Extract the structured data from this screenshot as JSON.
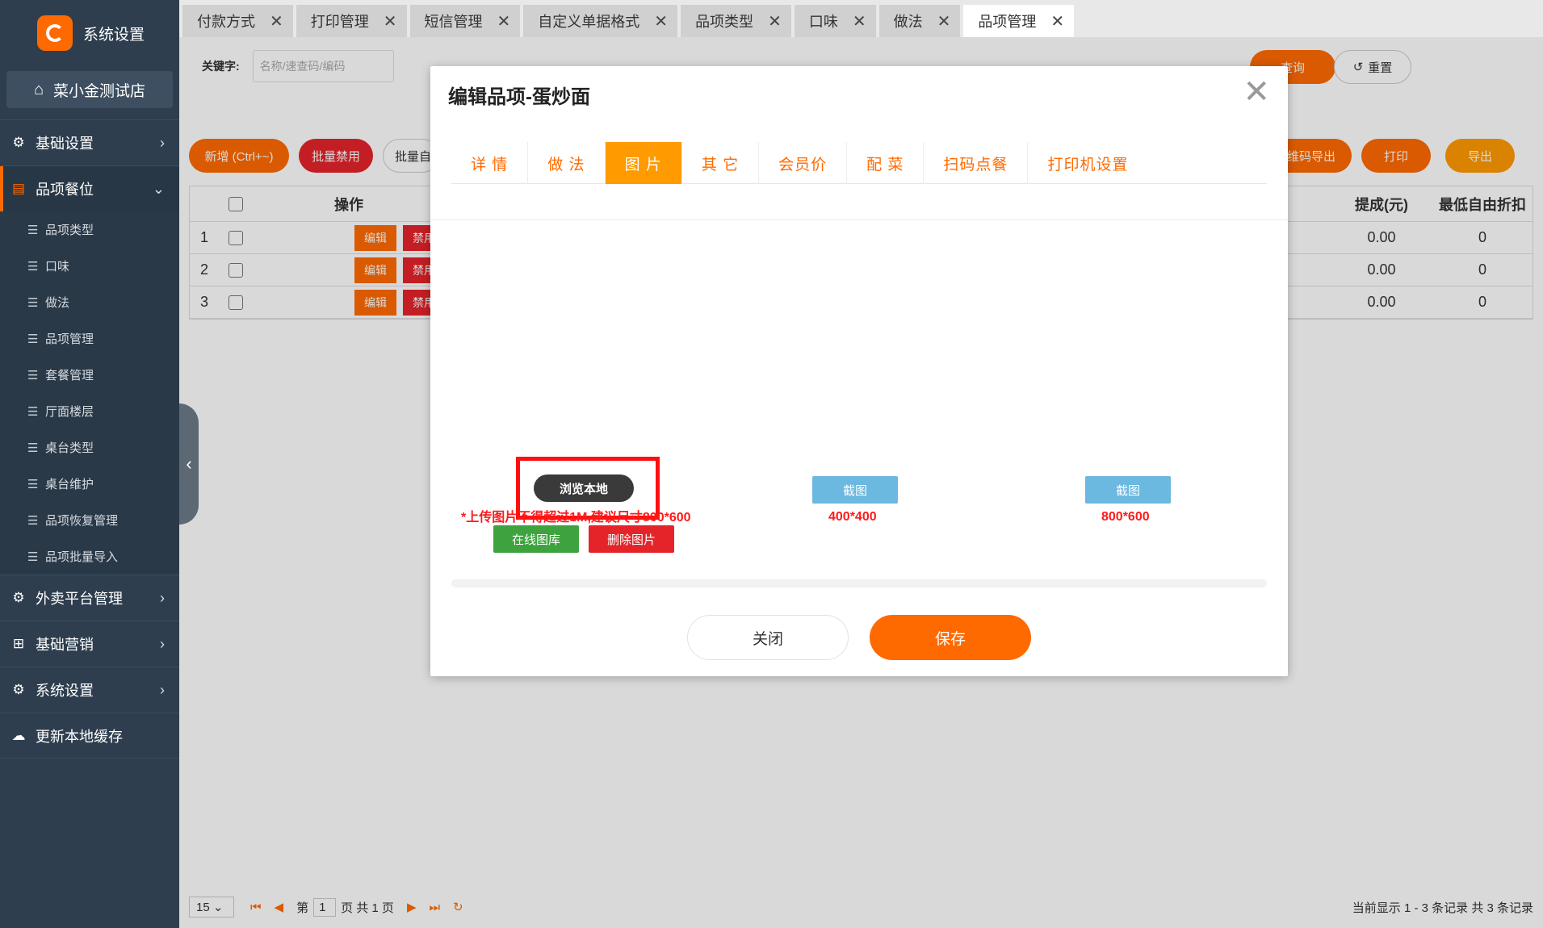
{
  "brand": {
    "title": "系统设置"
  },
  "store": {
    "name": "菜小金测试店"
  },
  "sidebar": {
    "groups": [
      {
        "label": "基础设置",
        "icon": "gear-icon"
      },
      {
        "label": "品项餐位",
        "icon": "document-icon"
      },
      {
        "label": "外卖平台管理",
        "icon": "gear-icon"
      },
      {
        "label": "基础营销",
        "icon": "gift-icon"
      },
      {
        "label": "系统设置",
        "icon": "settings-icon"
      },
      {
        "label": "更新本地缓存",
        "icon": "cloud-icon"
      }
    ],
    "sub_items": [
      "品项类型",
      "口味",
      "做法",
      "品项管理",
      "套餐管理",
      "厅面楼层",
      "桌台类型",
      "桌台维护",
      "品项恢复管理",
      "品项批量导入"
    ]
  },
  "tabs": [
    {
      "label": "付款方式"
    },
    {
      "label": "打印管理"
    },
    {
      "label": "短信管理"
    },
    {
      "label": "自定义单据格式"
    },
    {
      "label": "品项类型"
    },
    {
      "label": "口味"
    },
    {
      "label": "做法"
    },
    {
      "label": "品项管理"
    }
  ],
  "filter": {
    "keyword_label": "关键字:",
    "keyword_placeholder": "名称/速查码/编码",
    "query_label": "查询",
    "reset_label": "重置"
  },
  "toolbar": {
    "add_label": "新增 (Ctrl+~)",
    "batch_disable_label": "批量禁用",
    "batch_label": "批量自",
    "qr_export_label": "维码导出",
    "print_label": "打印",
    "export_label": "导出"
  },
  "table": {
    "headers": {
      "action": "操作",
      "commission": "提成(元)",
      "min_discount": "最低自由折扣"
    },
    "rows": [
      {
        "idx": "1",
        "edit": "编辑",
        "disable": "禁用",
        "commission": "0.00",
        "min_discount": "0"
      },
      {
        "idx": "2",
        "edit": "编辑",
        "disable": "禁用",
        "commission": "0.00",
        "min_discount": "0"
      },
      {
        "idx": "3",
        "edit": "编辑",
        "disable": "禁用",
        "commission": "0.00",
        "min_discount": "0"
      }
    ]
  },
  "pager": {
    "page_size": "15",
    "page_prefix": "第",
    "page_value": "1",
    "page_suffix": "页 共 1 页",
    "summary": "当前显示 1 - 3 条记录 共 3 条记录"
  },
  "modal": {
    "title": "编辑品项-蛋炒面",
    "tabs": [
      "详 情",
      "做 法",
      "图 片",
      "其 它",
      "会员价",
      "配 菜",
      "扫码点餐",
      "打印机设置"
    ],
    "active_tab_index": 2,
    "browse_label": "浏览本地",
    "hint": "*上传图片不得超过1M,建议尺寸800*600",
    "online_gallery_label": "在线图库",
    "delete_image_label": "删除图片",
    "crop_label_1": "截图",
    "size_1": "400*400",
    "crop_label_2": "截图",
    "size_2": "800*600",
    "close_label": "关闭",
    "save_label": "保存"
  },
  "colors": {
    "accent": "#ff6a00",
    "sidebar": "#2e3e4e",
    "danger": "#e5242a",
    "success": "#3ea33e",
    "info": "#6bb8e0"
  }
}
